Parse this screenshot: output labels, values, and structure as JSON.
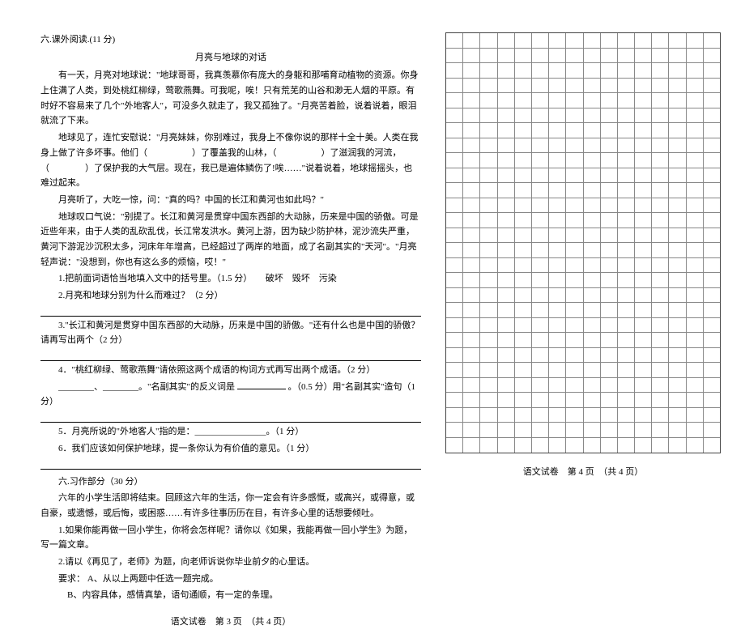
{
  "left": {
    "section_six_head": "六.课外阅读.(11 分)",
    "story_title": "月亮与地球的对话",
    "p1": "有一天，月亮对地球说：\"地球哥哥，我真羡慕你有庞大的身躯和那哺育动植物的资源。你身上住满了人类，到处桃红柳绿，莺歌燕舞。可我呢，唉！只有荒芜的山谷和渺无人烟的平原。有时好不容易来了几个\"外地客人\"，可没多久就走了，我又孤独了。\"月亮苦着脸，说着说着，眼泪就流了下来。",
    "p2": "地球见了，连忙安慰说：\"月亮妹妹，你别难过，我身上不像你说的那样十全十美。人类在我身上做了许多坏事。他们（　　　　　）了覆盖我的山林，（　　　　　）了滋润我的河流，（　　　　）了保护我的大气层。现在，我已是遍体鳞伤了!唉……\"说着说着，地球摇摇头，也难过起来。",
    "p3": "月亮听了，大吃一惊，问：\"真的吗？中国的长江和黄河也如此吗？\"",
    "p4": "地球叹口气说：\"别提了。长江和黄河是贯穿中国东西部的大动脉，历来是中国的骄傲。可是近些年来，由于人类的乱砍乱伐，长江常发洪水。黄河上游，因为缺少防护林，泥沙流失严重，黄河下游泥沙沉积太多，河床年年增高，已经超过了两岸的地面，成了名副其实的\"天河\"。\"月亮轻声说：\"没想到，你也有这么多的烦恼，哎！\"",
    "q1": "1.把前面词语恰当地填入文中的括号里。（1.5 分）　　破坏　毁坏　污染",
    "q2": "2.月亮和地球分别为什么而难过？（2 分）",
    "q3": "3.\"长江和黄河是贯穿中国东西部的大动脉，历来是中国的骄傲。\"还有什么也是中国的骄傲？请再写出两个（2 分）",
    "q4a": "4．\"桃红柳绿、莺歌燕舞\"请依照这两个成语的构词方式再写出两个成语。（2 分）",
    "q4b_prefix": "________、________。\"名副其实\"的反义词是",
    "q4b_suffix": "。（0.5 分）用\"名副其实\"造句（1 分）",
    "q5": "5．月亮所说的\"外地客人\"指的是：________________。（1 分）",
    "q6": "6．我们应该如何保护地球，提一条你认为有价值的意见。（1 分）",
    "divider_gap": "",
    "essay_head": "六.习作部分（30 分）",
    "essay_intro": "六年的小学生活即将结束。回顾这六年的生活，你一定会有许多感慨，或高兴，或得意，或自豪，或遗憾，或后悔，或困惑……有许多往事历历在目，有许多心里的话想要倾吐。",
    "essay_opt1": "1.如果你能再做一回小学生，你将会怎样呢？请你以《如果，我能再做一回小学生》为题，写一篇文章。",
    "essay_opt2": "2.请以《再见了，老师》为题，向老师诉说你毕业前夕的心里话。",
    "req_label": "要求：",
    "req_a": "A、从以上两题中任选一题完成。",
    "req_b": "B、内容具体，感情真挚，语句通顺，有一定的条理。",
    "footer_left": "语文试卷　第 3 页　（共 4 页）"
  },
  "right": {
    "footer_right": "语文试卷　第 4 页　（共 4 页）"
  },
  "grid": {
    "rows": 28,
    "cols": 16
  }
}
